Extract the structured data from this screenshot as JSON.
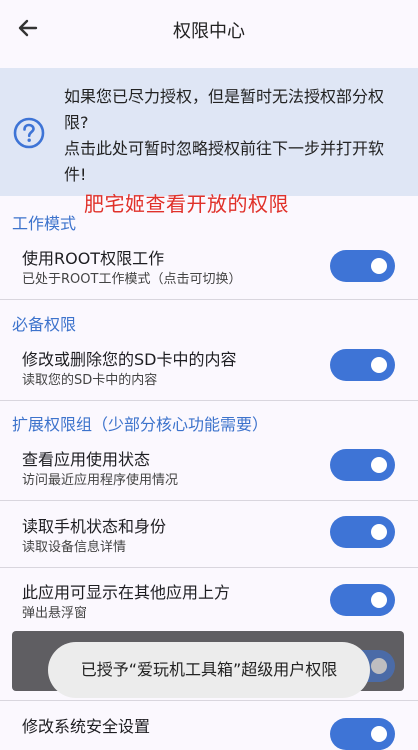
{
  "header": {
    "title": "权限中心",
    "back_icon": "arrow-left-icon"
  },
  "notice": {
    "icon": "help-circle-icon",
    "line1": "如果您已尽力授权，但是暂时无法授权部分权",
    "line2": "限?",
    "line3": "点击此处可暂时忽略授权前往下一步并打开软",
    "line4": "件!"
  },
  "watermark": "肥宅姬查看开放的权限",
  "sections": {
    "work_mode": "工作模式",
    "required": "必备权限",
    "extended": "扩展权限组（少部分核心功能需要）"
  },
  "rows": [
    {
      "title": "使用ROOT权限工作",
      "subtitle": "已处于ROOT工作模式（点击可切换）",
      "enabled": true
    },
    {
      "title": "修改或删除您的SD卡中的内容",
      "subtitle": "读取您的SD卡中的内容",
      "enabled": true
    },
    {
      "title": "查看应用使用状态",
      "subtitle": "访问最近应用程序使用情况",
      "enabled": true
    },
    {
      "title": "读取手机状态和身份",
      "subtitle": "读取设备信息详情",
      "enabled": true
    },
    {
      "title": "此应用可显示在其他应用上方",
      "subtitle": "弹出悬浮窗",
      "enabled": true
    },
    {
      "title": "修改系统安全设置",
      "enabled": true
    }
  ],
  "toast": "已授予“爱玩机工具箱”超级用户权限",
  "colors": {
    "accent": "#3e74d6",
    "notice_bg": "#dfe6f5",
    "watermark": "#e0312a"
  }
}
